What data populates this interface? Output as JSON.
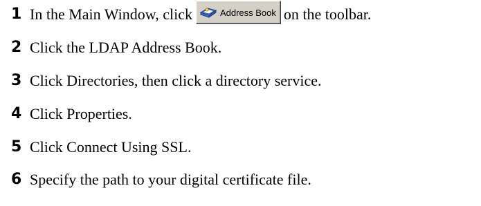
{
  "steps": [
    {
      "number": "1",
      "before": "In the Main Window, click",
      "button_label": "Address Book",
      "after": "on the toolbar."
    },
    {
      "number": "2",
      "text": "Click the LDAP Address Book."
    },
    {
      "number": "3",
      "text": "Click Directories, then click a directory service."
    },
    {
      "number": "4",
      "text": "Click Properties."
    },
    {
      "number": "5",
      "text": "Click Connect Using SSL."
    },
    {
      "number": "6",
      "text": "Specify the path to your digital certificate file."
    }
  ],
  "icons": {
    "address_book": "address-book-icon"
  },
  "colors": {
    "button_face": "#d4d0c8",
    "icon_blue": "#3a6fc4"
  }
}
